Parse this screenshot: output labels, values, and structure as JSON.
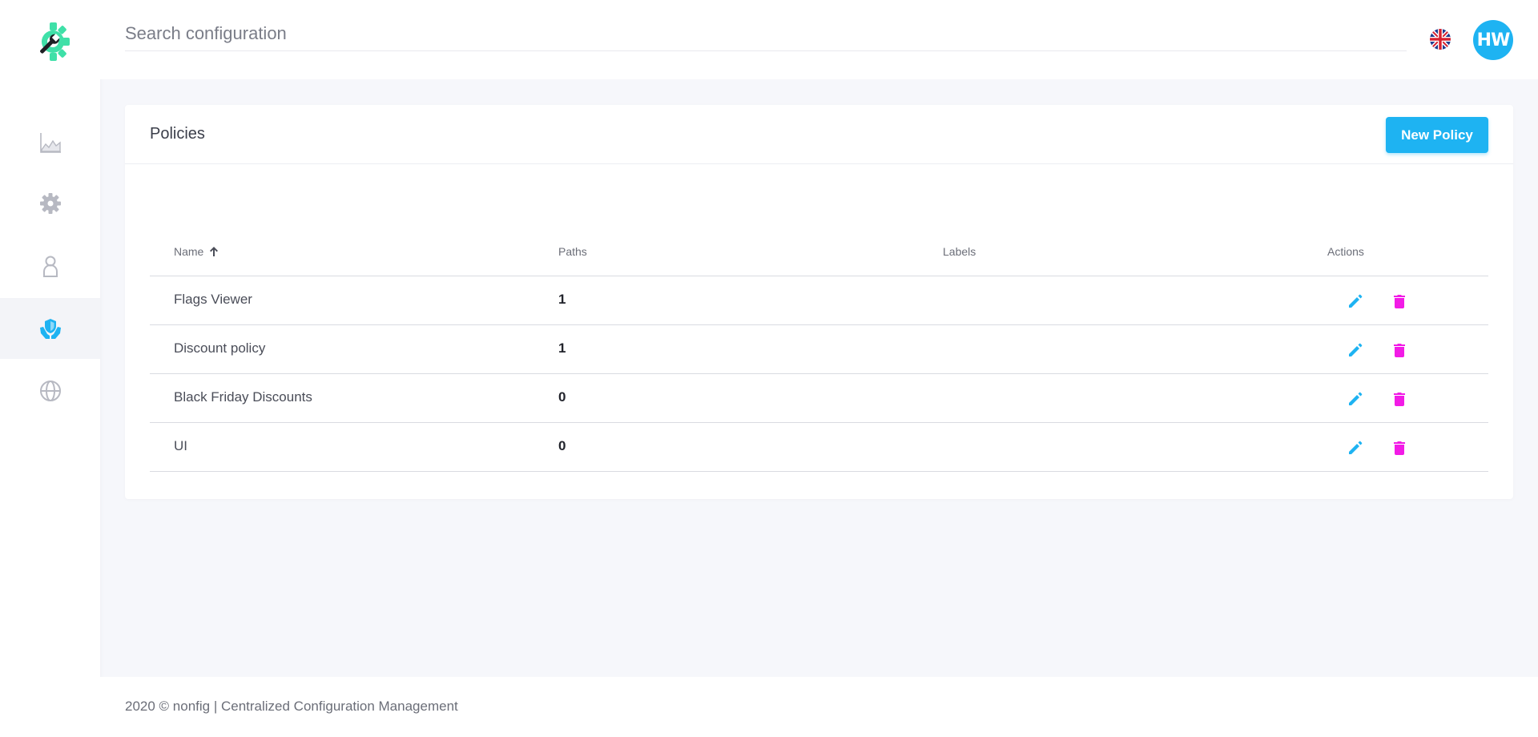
{
  "search": {
    "placeholder": "Search configuration"
  },
  "user": {
    "initials": "HW"
  },
  "nav": {
    "items": [
      {
        "name": "metrics",
        "active": false
      },
      {
        "name": "settings",
        "active": false
      },
      {
        "name": "users",
        "active": false
      },
      {
        "name": "policies",
        "active": true
      },
      {
        "name": "environments",
        "active": false
      }
    ]
  },
  "card": {
    "title": "Policies",
    "new_button_label": "New Policy"
  },
  "table": {
    "columns": {
      "name": "Name",
      "paths": "Paths",
      "labels": "Labels",
      "actions": "Actions"
    },
    "rows": [
      {
        "name": "Flags Viewer",
        "paths": "1",
        "labels": ""
      },
      {
        "name": "Discount policy",
        "paths": "1",
        "labels": ""
      },
      {
        "name": "Black Friday Discounts",
        "paths": "0",
        "labels": ""
      },
      {
        "name": "UI",
        "paths": "0",
        "labels": ""
      }
    ]
  },
  "footer": {
    "text": "2020 © nonfig | Centralized Configuration Management"
  },
  "colors": {
    "accent": "#1eb3f2",
    "delete": "#f21be6",
    "icon_inactive": "#b7b9c2"
  }
}
